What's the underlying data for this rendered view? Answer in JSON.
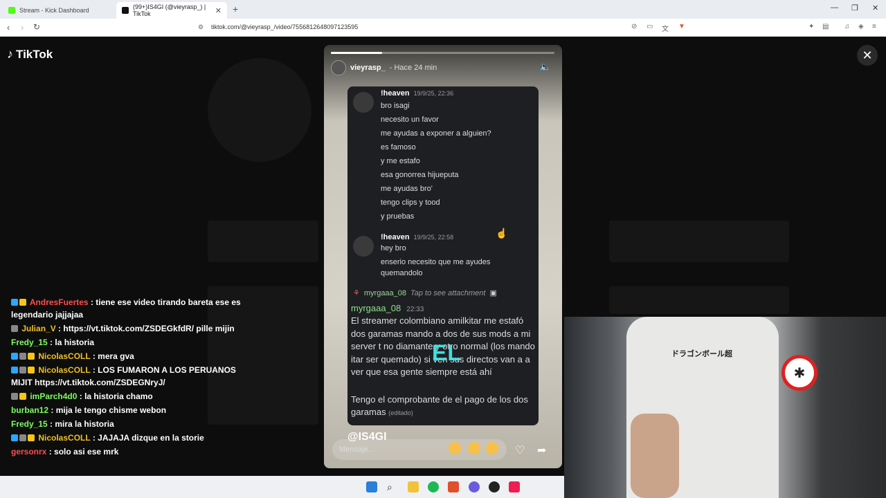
{
  "browser": {
    "tabs": [
      {
        "title": "Stream - Kick Dashboard",
        "favicon_color": "#53fc18"
      },
      {
        "title": "(99+)IS4GI (@vieyrasp_) | TikTok",
        "favicon_color": "#111111"
      }
    ],
    "url": "tiktok.com/@vieyrasp_/video/7556812648097123595"
  },
  "tiktok": {
    "logo": "TikTok"
  },
  "chat": [
    {
      "user": "AndresFuertes",
      "user_color": "#ff4d4d",
      "text": ": tiene ese video tirando bareta ese es legendario jajjajaa",
      "badges": [
        "#2aa8ff",
        "#f5c518"
      ]
    },
    {
      "user": "Julian_V",
      "user_color": "#f0c020",
      "text": ": https://vt.tiktok.com/ZSDEGkfdR/ pille mijin",
      "badges": [
        "#888888"
      ]
    },
    {
      "user": "Fredy_15",
      "user_color": "#7cff5c",
      "text": ": la historia",
      "badges": []
    },
    {
      "user": "NicolasCOLL",
      "user_color": "#f0c020",
      "text": ": mera gva",
      "badges": [
        "#2aa8ff",
        "#888888",
        "#f5c518"
      ]
    },
    {
      "user": "NicolasCOLL",
      "user_color": "#f0c020",
      "text": ": LOS FUMARON A LOS PERUANOS MIJIT https://vt.tiktok.com/ZSDEGNryJ/",
      "badges": [
        "#2aa8ff",
        "#888888",
        "#f5c518"
      ]
    },
    {
      "user": "imParch4d0",
      "user_color": "#7cff5c",
      "text": ": la historia chamo",
      "badges": [
        "#888888",
        "#f5c518"
      ]
    },
    {
      "user": "burban12",
      "user_color": "#7cff5c",
      "text": ": mija le tengo chisme webon",
      "badges": []
    },
    {
      "user": "Fredy_15",
      "user_color": "#7cff5c",
      "text": ": mira la historia",
      "badges": []
    },
    {
      "user": "NicolasCOLL",
      "user_color": "#f0c020",
      "text": ": JAJAJA dizque en la storie",
      "badges": [
        "#2aa8ff",
        "#888888",
        "#f5c518"
      ]
    },
    {
      "user": "gersonrx",
      "user_color": "#ff4d4d",
      "text": ": solo asi ese mrk",
      "badges": []
    }
  ],
  "story": {
    "progress": 0.23,
    "user": "vieyrasp_",
    "time": "- Hace 24 min",
    "discord": {
      "msg1": {
        "name": "!heaven",
        "date": "19/9/25, 22:36",
        "lines": [
          "bro isagi",
          "necesito un favor",
          "me ayudas a exponer a alguien?",
          "es famoso",
          "y me estafo",
          "esa gonorrea hijueputa",
          "me ayudas bro'",
          "tengo clips y tood",
          "y pruebas"
        ]
      },
      "msg2": {
        "name": "!heaven",
        "date": "19/9/25, 22:58",
        "lines": [
          "hey bro",
          "enserio necesito que me ayudes",
          "quemandolo"
        ]
      },
      "reply": {
        "name": "myrgaaa_08",
        "tap": "Tap to see attachment"
      },
      "msg3": {
        "name": "myrgaaa_08",
        "date": "22:33",
        "text": "El streamer colombiano amilkitar me estafó dos garamas mando a dos de sus mods a mi server t     no diamante y otro normal (los mando      itar ser quemado) si ven sus directos van a a ver que esa gente siempre está ahí",
        "text2": "Tengo el comprobante de el pago de los dos garamas",
        "edited": "(editado)"
      }
    },
    "overlay_text": "EL",
    "caption": "@IS4GI",
    "message_placeholder": "Mensaje..."
  },
  "webcam": {
    "shirt_text": "ドラゴンボール超"
  }
}
